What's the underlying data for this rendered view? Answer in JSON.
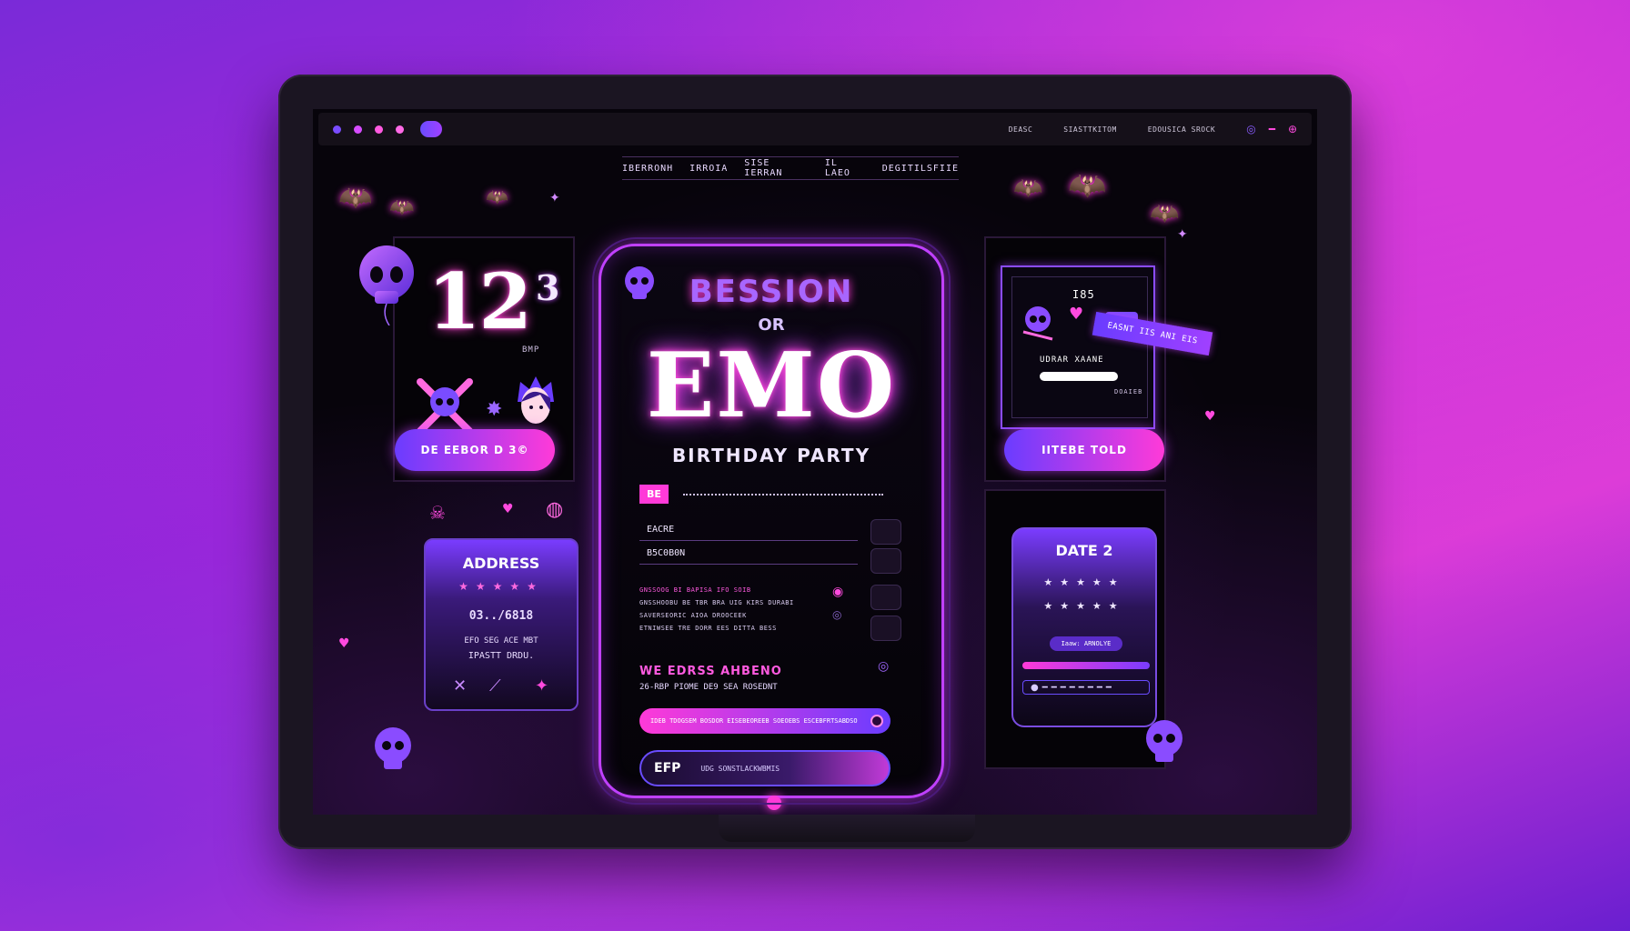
{
  "browser": {
    "nav": [
      "DEASC",
      "SIASTTKITOM",
      "EDOUSICA SROCK"
    ]
  },
  "ticker": [
    "IBERRONH",
    "IRROIA",
    "SISE IERRAN",
    "IL LAEO",
    "DEGITILSFIIE"
  ],
  "left_top": {
    "big_number": "12",
    "big_sup": "3",
    "label": "BMP",
    "button": "DE EEBOR D 3©"
  },
  "address_card": {
    "title": "ADDRESS",
    "stars": "★★★★★",
    "code": "03../6818",
    "line1": "EFO  SEG  ACE  MBT",
    "line2": "IPASTT  DRDU."
  },
  "invite": {
    "arc_title": "BESSION",
    "or": "OR",
    "main_title": "EMO",
    "subtitle": "BIRTHDAY PARTY",
    "tag": "BE",
    "field1": "EACRE",
    "field2": "B5C0B0N",
    "mini1": "GNSSOOG  BI  BAPISA  IFO  SOIB",
    "mini2": "GNSSHOOBU  BE TBR  BRA  UIG  KIRS  DURABI",
    "mini3": "SAVERSEORIC  AIOA  DROOCEEK",
    "mini4": "ETNIWSEE  TRE  DORR  EES  DITTA  BESS",
    "we_title": "WE EDRSS AHBENO",
    "we_sub": "26-RBP  PIOME  DE9  SEA  ROSEDNT",
    "input_text": "IDEB  TDOGSEM  BOSDOR  EISEBEOREEB  SOEOEBS  ESCEBFRTSABDSO",
    "submit_main": "EFP",
    "submit_sub": "UDG  SONSTLACKWBMIS"
  },
  "right_top": {
    "monitor_label": "I85",
    "monitor_name": "UDRAR XAANE",
    "monitor_small": "DOAIEB",
    "ribbon": "EASNT IIS ANI EIS",
    "button": "IITEBE TOLD"
  },
  "date_card": {
    "title": "DATE 2",
    "stars1": "★★★★★",
    "stars2": "★★★★★",
    "chip": "Iaaw: ARNOLYE",
    "dots": "●━━━━━━━━"
  },
  "colors": {
    "accent_pink": "#ff3ad8",
    "accent_purple": "#6a3cff",
    "screen_bg": "#07040b"
  }
}
